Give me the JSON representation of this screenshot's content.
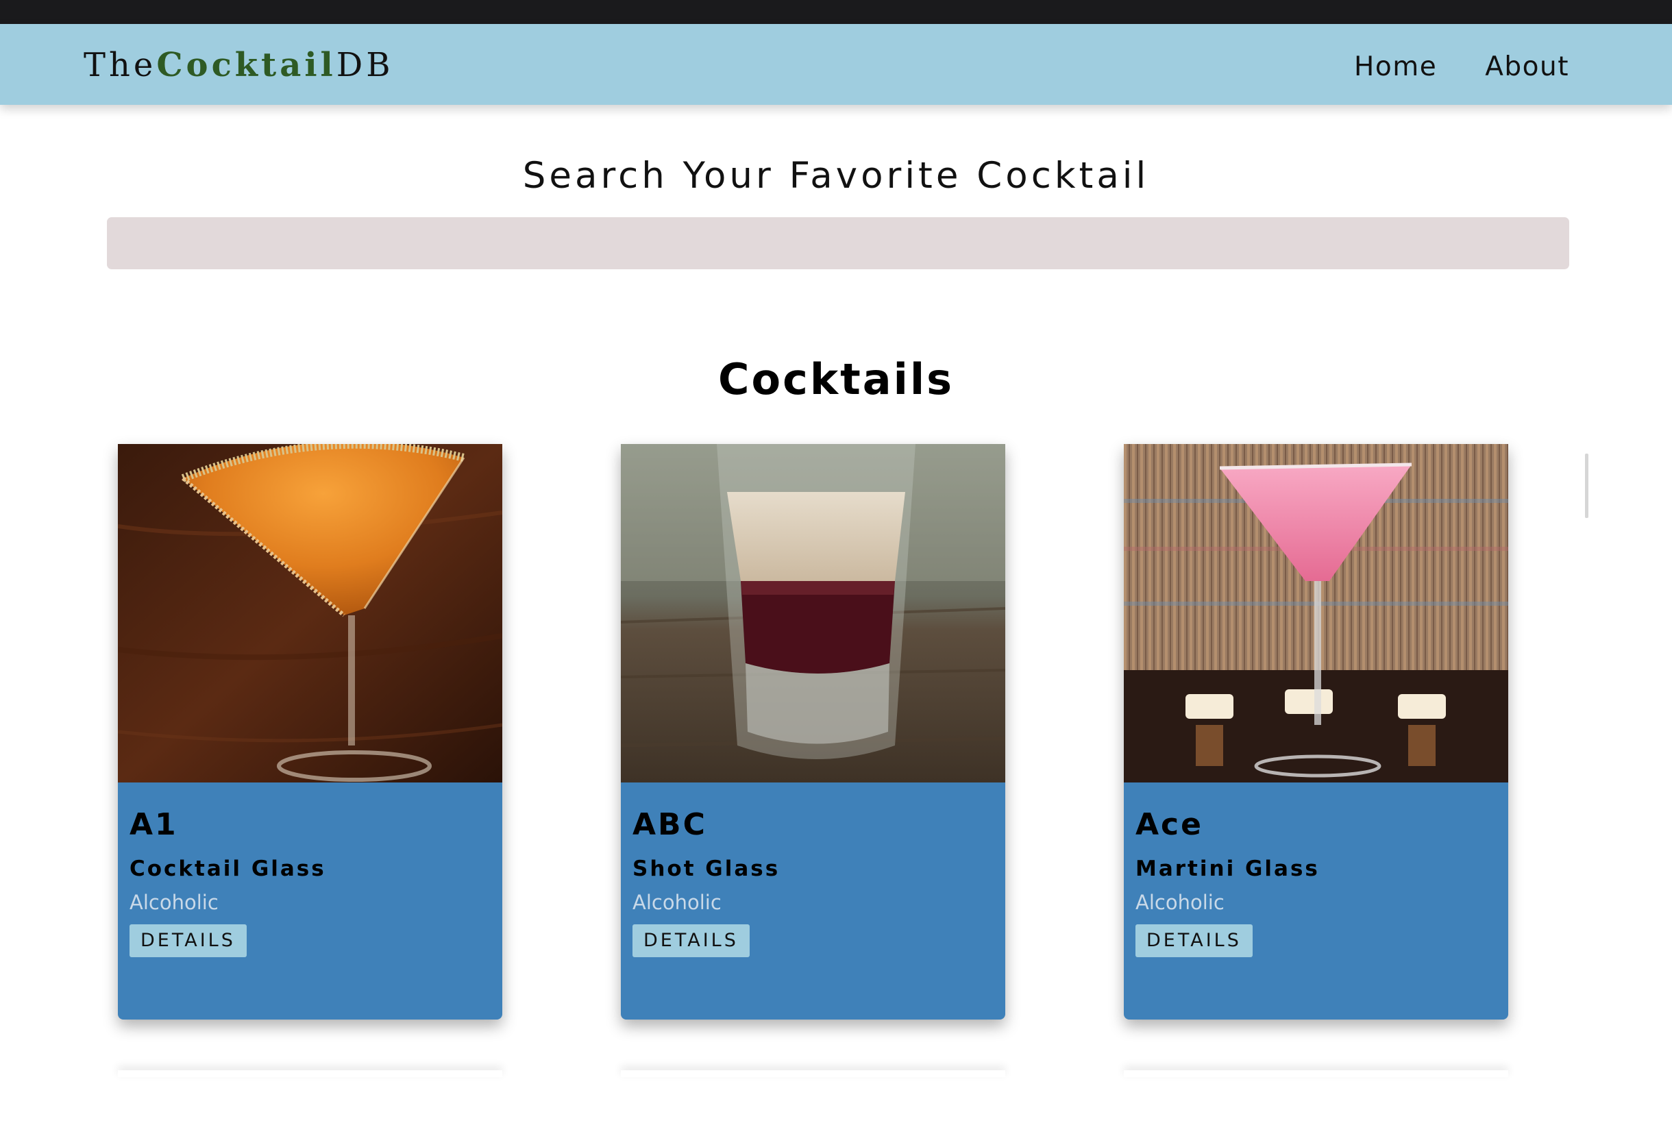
{
  "site": {
    "logo_prefix": "The",
    "logo_mid": "Cocktail",
    "logo_suffix": "DB"
  },
  "nav": {
    "items": [
      {
        "label": "Home"
      },
      {
        "label": "About"
      }
    ]
  },
  "search": {
    "title": "Search Your Favorite Cocktail",
    "value": "",
    "placeholder": ""
  },
  "section": {
    "title": "Cocktails"
  },
  "cocktails": [
    {
      "name": "A1",
      "glass": "Cocktail Glass",
      "type": "Alcoholic",
      "button": "DETAILS",
      "image_icon": "orange-martini-photo"
    },
    {
      "name": "ABC",
      "glass": "Shot Glass",
      "type": "Alcoholic",
      "button": "DETAILS",
      "image_icon": "layered-shot-photo"
    },
    {
      "name": "Ace",
      "glass": "Martini Glass",
      "type": "Alcoholic",
      "button": "DETAILS",
      "image_icon": "pink-martini-photo"
    }
  ],
  "colors": {
    "navbar": "#9fcddf",
    "card": "#3f81b9",
    "logo_accent": "#2e5a24",
    "search_bg": "#e2d9da"
  }
}
